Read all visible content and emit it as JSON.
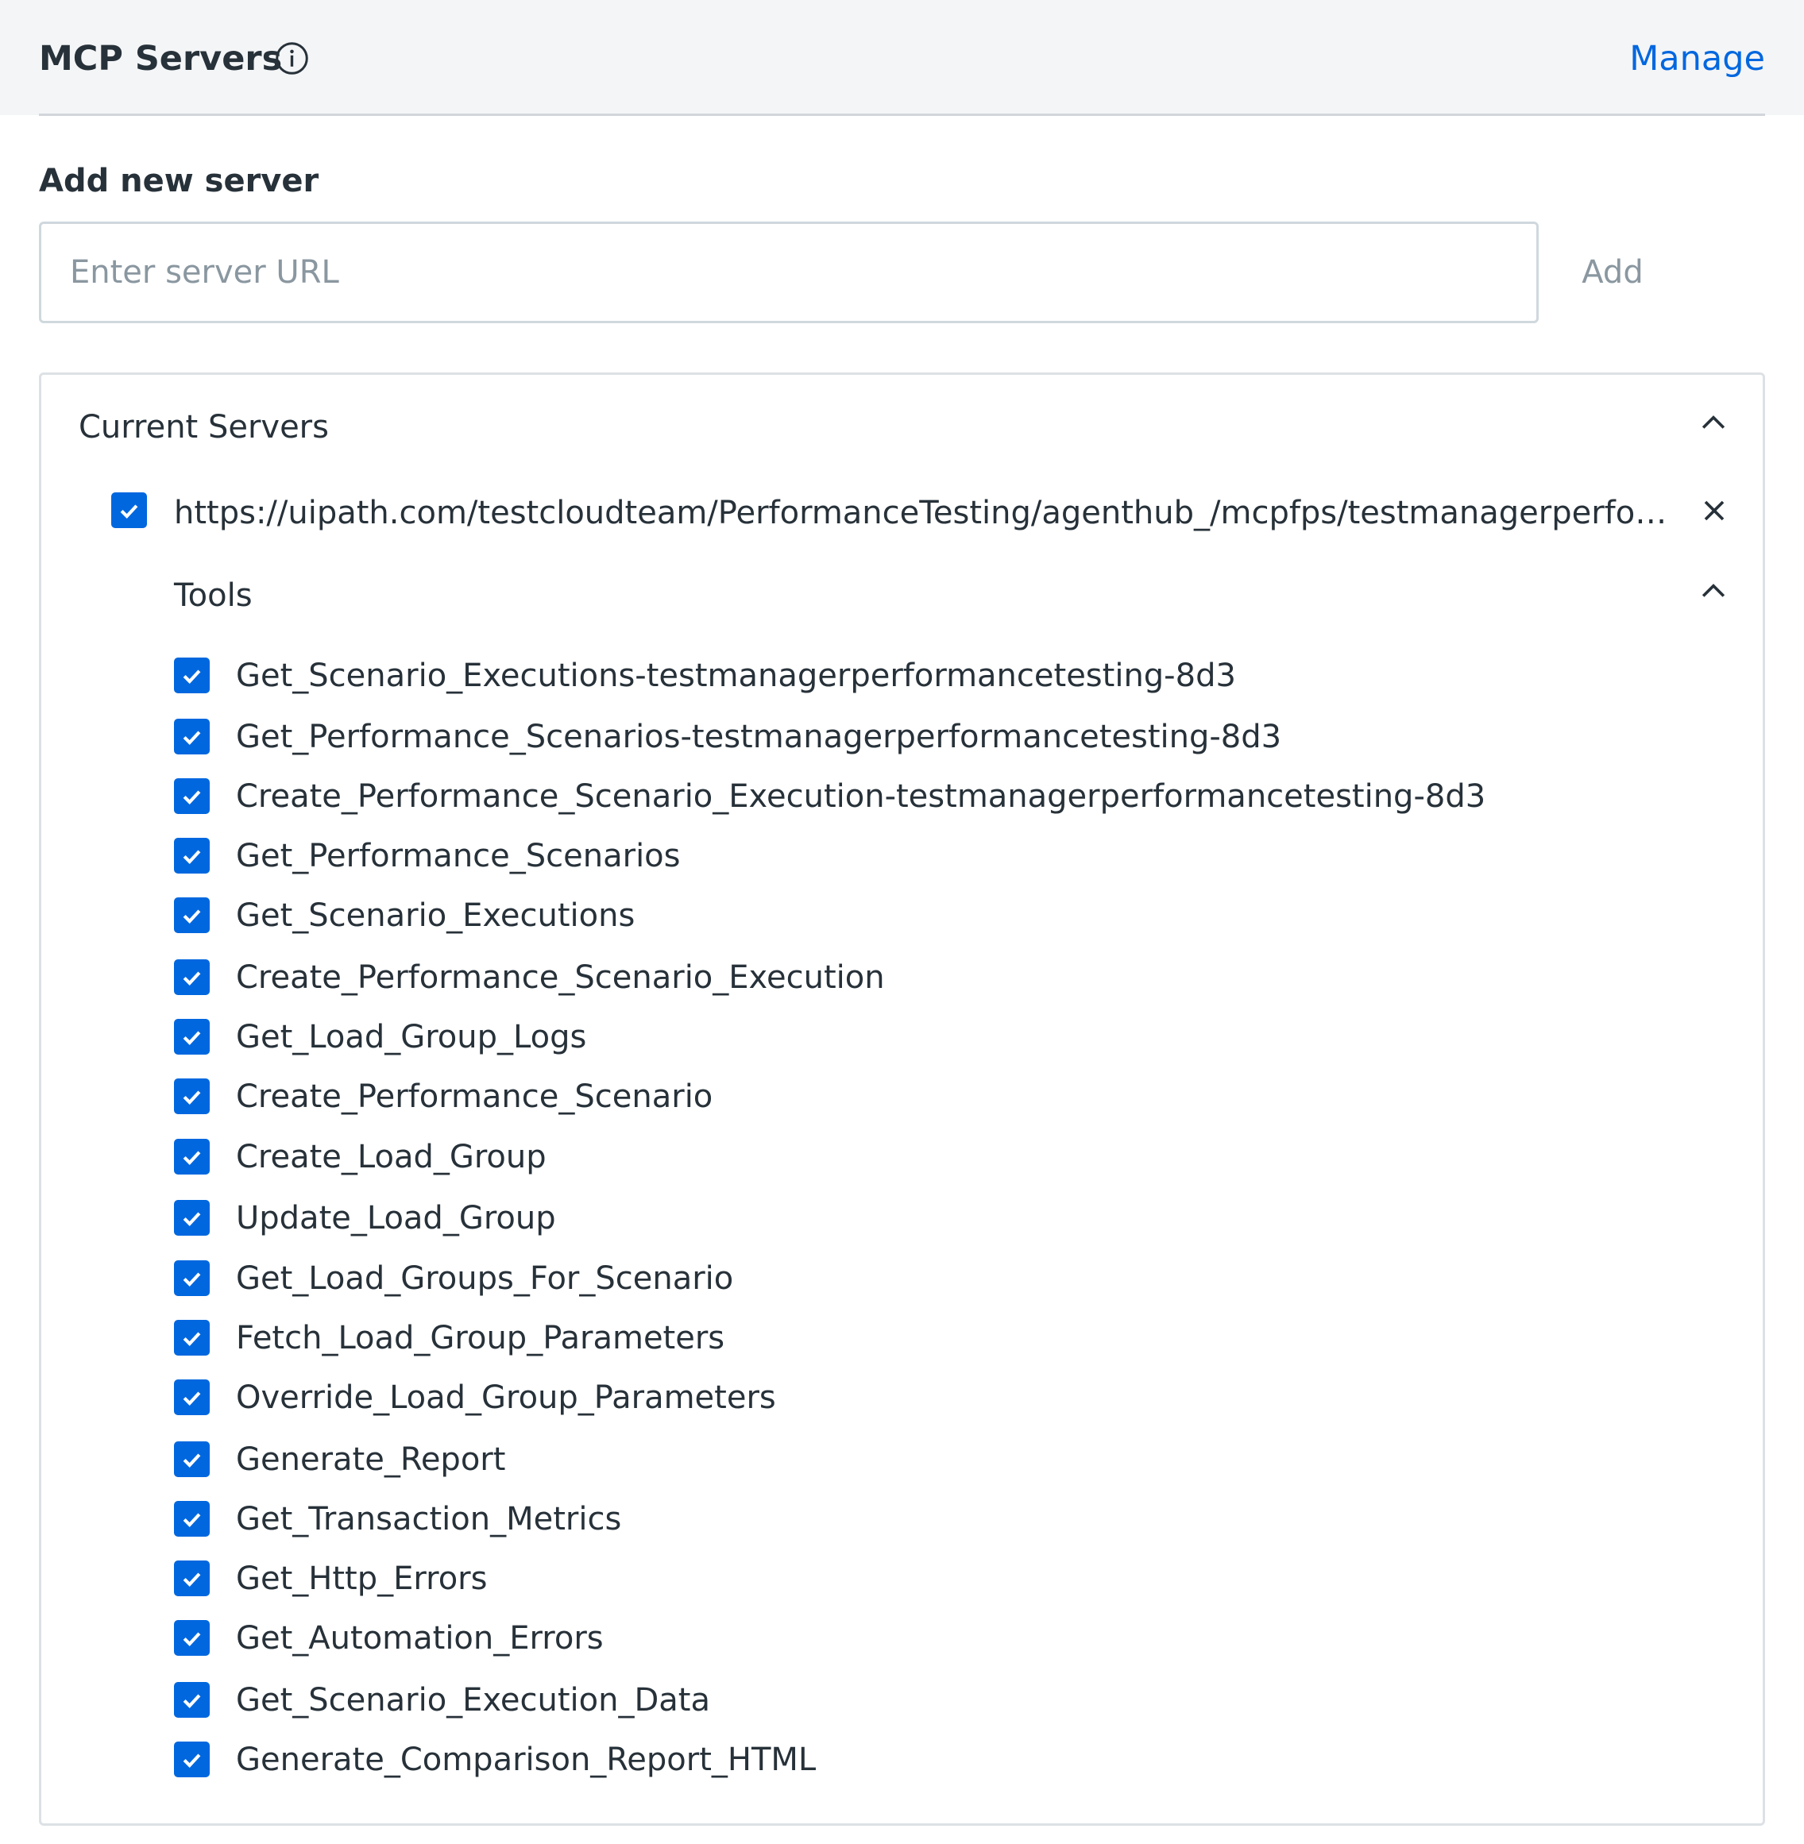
{
  "header": {
    "title": "MCP Servers",
    "info_icon": "info-circle-icon",
    "manage_label": "Manage"
  },
  "add_server": {
    "label": "Add new server",
    "input_value": "",
    "input_placeholder": "Enter server URL",
    "button_label": "Add"
  },
  "current_servers": {
    "title": "Current Servers",
    "expanded": true,
    "servers": [
      {
        "checked": true,
        "url": "https://uipath.com/testcloudteam/PerformanceTesting/agenthub_/mcpfps/testmanagerperformance...",
        "tools_title": "Tools",
        "tools_expanded": true,
        "tools": [
          {
            "label": "Get_Scenario_Executions-testmanagerperformancetesting-8d3",
            "checked": true
          },
          {
            "label": "Get_Performance_Scenarios-testmanagerperformancetesting-8d3",
            "checked": true
          },
          {
            "label": "Create_Performance_Scenario_Execution-testmanagerperformancetesting-8d3",
            "checked": true
          },
          {
            "label": "Get_Performance_Scenarios",
            "checked": true
          },
          {
            "label": "Get_Scenario_Executions",
            "checked": true
          },
          {
            "label": "Create_Performance_Scenario_Execution",
            "checked": true
          },
          {
            "label": "Get_Load_Group_Logs",
            "checked": true
          },
          {
            "label": "Create_Performance_Scenario",
            "checked": true
          },
          {
            "label": "Create_Load_Group",
            "checked": true
          },
          {
            "label": "Update_Load_Group",
            "checked": true
          },
          {
            "label": "Get_Load_Groups_For_Scenario",
            "checked": true
          },
          {
            "label": "Fetch_Load_Group_Parameters",
            "checked": true
          },
          {
            "label": "Override_Load_Group_Parameters",
            "checked": true
          },
          {
            "label": "Generate_Report",
            "checked": true
          },
          {
            "label": "Get_Transaction_Metrics",
            "checked": true
          },
          {
            "label": "Get_Http_Errors",
            "checked": true
          },
          {
            "label": "Get_Automation_Errors",
            "checked": true
          },
          {
            "label": "Get_Scenario_Execution_Data",
            "checked": true
          },
          {
            "label": "Generate_Comparison_Report_HTML",
            "checked": true
          }
        ]
      }
    ]
  },
  "colors": {
    "accent": "#0067df",
    "text": "#273139",
    "muted": "#8a97a0",
    "header_bg": "#f4f5f7",
    "border": "#cfd8dd"
  }
}
